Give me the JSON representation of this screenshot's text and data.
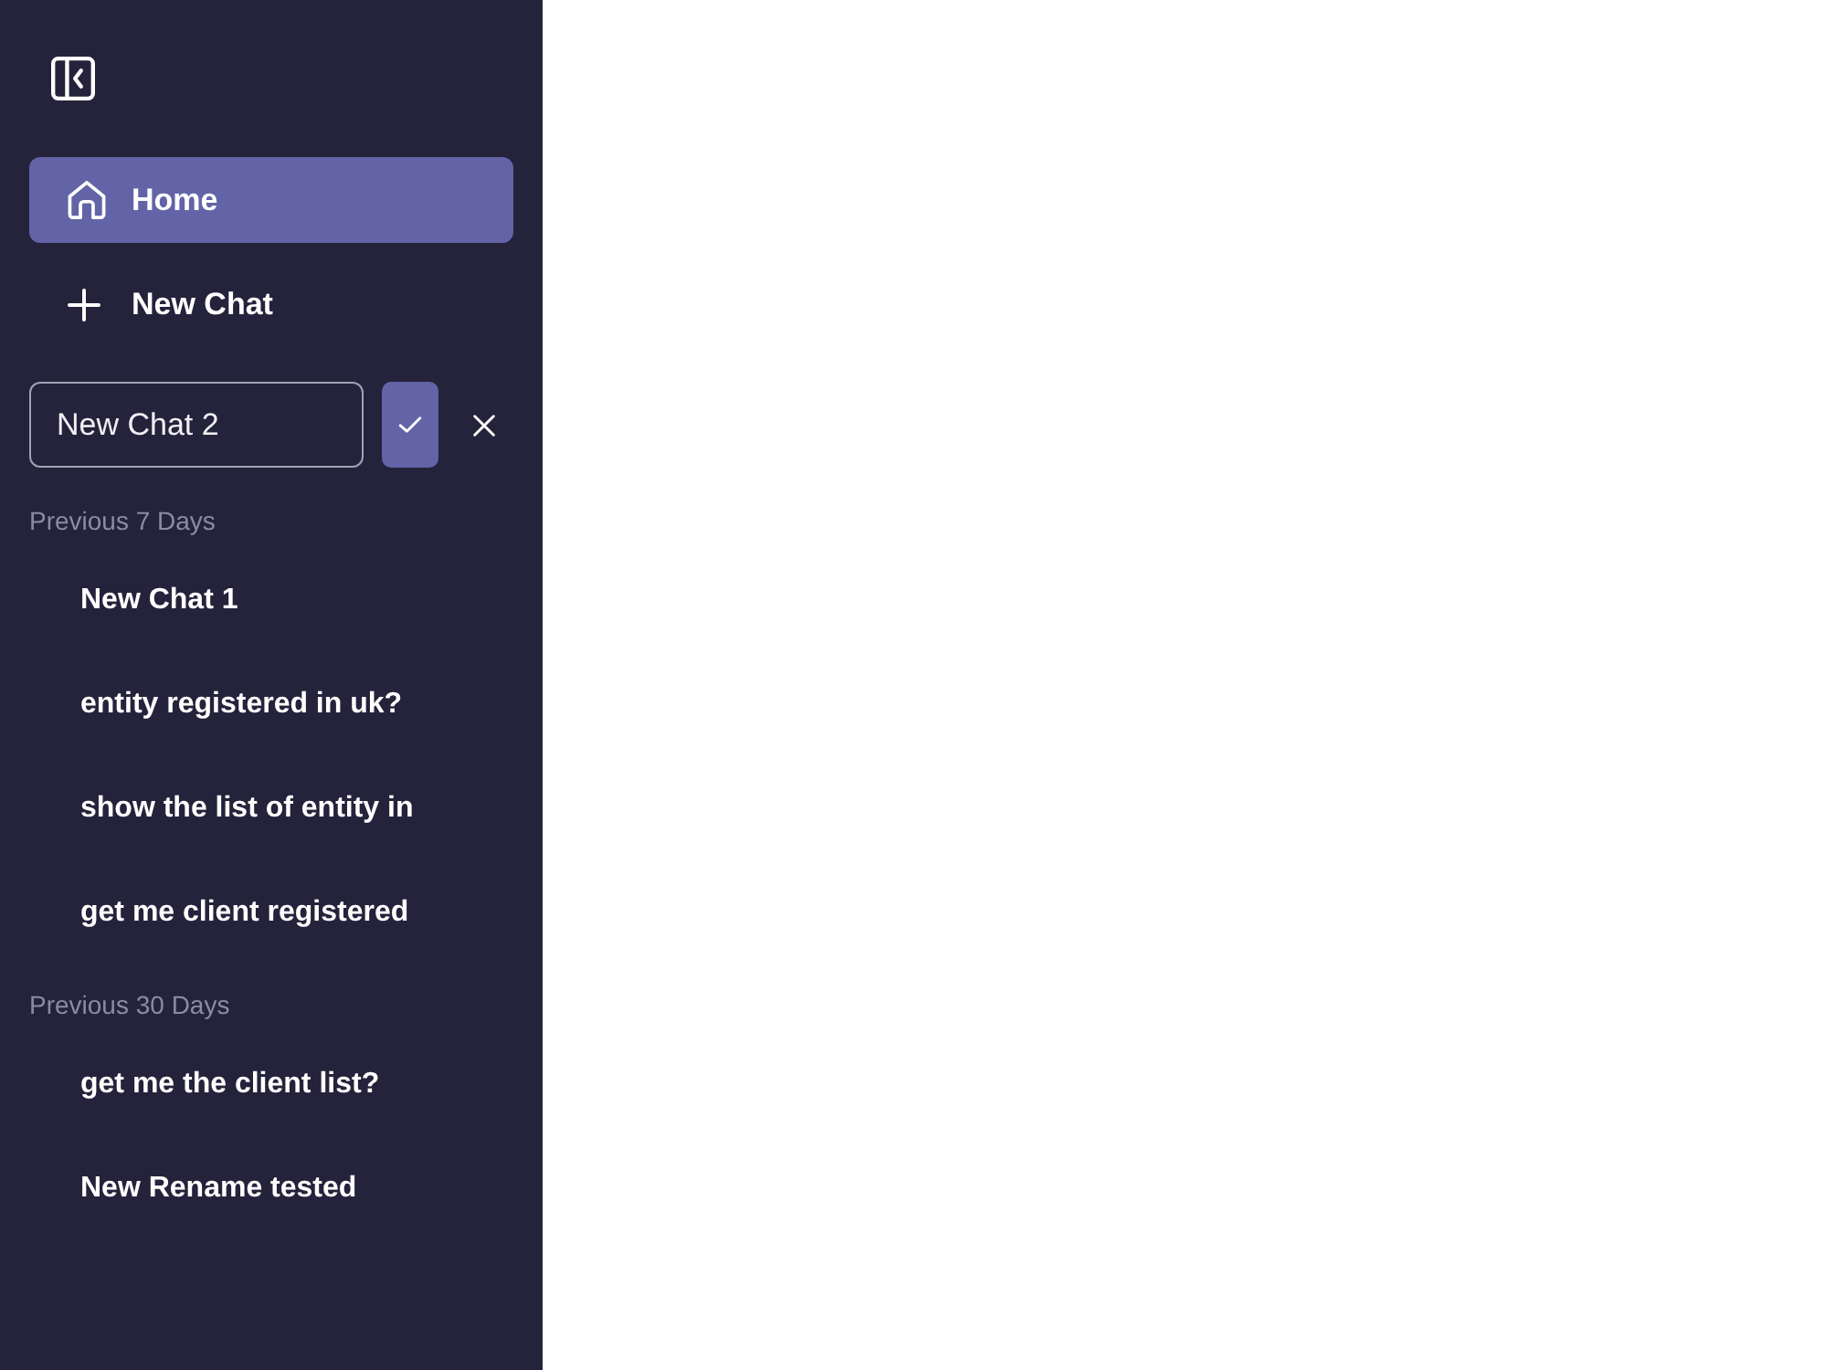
{
  "sidebar": {
    "nav": [
      {
        "label": "Home",
        "kind": "home",
        "selected": true
      },
      {
        "label": "New Chat",
        "kind": "add",
        "selected": false
      }
    ],
    "rename": {
      "value": "New Chat 2"
    },
    "sections": [
      {
        "title": "Previous 7 Days",
        "chats": [
          {
            "title": "New Chat 1"
          },
          {
            "title": "entity registered in uk?"
          },
          {
            "title": "show the list of entity in"
          },
          {
            "title": "get me client registered"
          }
        ]
      },
      {
        "title": "Previous 30 Days",
        "chats": [
          {
            "title": "get me the client list?"
          },
          {
            "title": "New Rename tested"
          }
        ]
      }
    ]
  }
}
